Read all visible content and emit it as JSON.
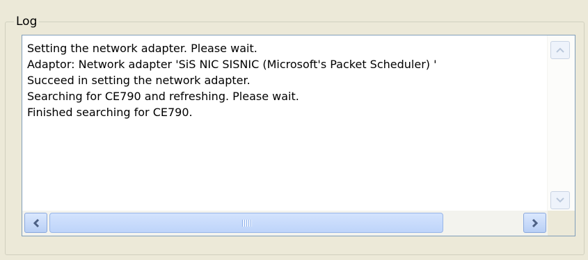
{
  "group_label": "Log",
  "log_lines": [
    "Setting the network adapter. Please wait.",
    "Adaptor: Network adapter 'SiS NIC SISNIC (Microsoft's Packet Scheduler) '",
    "Succeed in setting the network adapter.",
    "Searching for CE790 and refreshing. Please wait.",
    "Finished searching for CE790."
  ],
  "icons": {
    "scroll_up": "chevron-up-icon",
    "scroll_down": "chevron-down-icon",
    "scroll_left": "chevron-left-icon",
    "scroll_right": "chevron-right-icon",
    "grip": "grip-icon"
  },
  "scroll": {
    "horizontal_thumb_fraction": 0.95
  },
  "colors": {
    "window_bg": "#ece9d8",
    "border": "#7f9db9",
    "scroll_thumb": "#bed4fa",
    "arrow": "#4d6185"
  }
}
